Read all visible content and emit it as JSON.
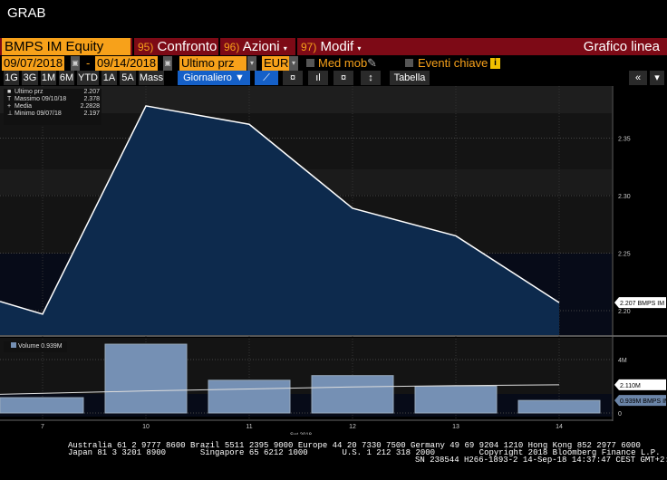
{
  "window_title": "GRAB",
  "menu": {
    "ticker": "BMPS IM Equity",
    "confronto": "Confronto",
    "confronto_num": "95)",
    "azioni": "Azioni",
    "azioni_num": "96)",
    "modif": "Modif",
    "modif_num": "97)",
    "chart_type": "Grafico linea"
  },
  "controls": {
    "start_date": "09/07/2018",
    "dash": "-",
    "end_date": "09/14/2018",
    "field": "Ultimo prz",
    "currency": "EUR",
    "med_mob": "Med mob",
    "eventi": "Eventi chiave"
  },
  "periods": [
    "1G",
    "3G",
    "1M",
    "6M",
    "YTD",
    "1A",
    "5A",
    "Mass"
  ],
  "frequency": "Giornaliero ▼",
  "tabella": "Tabella",
  "legend": [
    {
      "label": "Ultimo prz",
      "value": "2.207"
    },
    {
      "label": "Massimo 09/10/18",
      "value": "2.378"
    },
    {
      "label": "Media",
      "value": "2.2828"
    },
    {
      "label": "Minimo 09/07/18",
      "value": "2.197"
    }
  ],
  "volume_legend": "Volume 0.939M",
  "price_tag": "2.207 BMPS IM",
  "avg_vol_tag": "2.110M",
  "vol_tag": "0.939M BMPS IM",
  "footer": {
    "line1": "Australia 61 2 9777 8600 Brazil 5511 2395 9000 Europe 44 20 7330 7500 Germany 49 69 9204 1210 Hong Kong 852 2977 6000",
    "line2": "Japan 81 3 3201 8900       Singapore 65 6212 1000       U.S. 1 212 318 2000         Copyright 2018 Bloomberg Finance L.P.",
    "line3": "SN 238544 H266-1893-2 14-Sep-18 14:37:47 CEST GMT+2:00"
  },
  "chart_data": {
    "type": "line",
    "x": [
      "7",
      "10",
      "11",
      "12",
      "13",
      "14"
    ],
    "xlabel": "Set 2018",
    "price": {
      "name": "Ultimo prz",
      "values": [
        2.197,
        2.378,
        2.362,
        2.289,
        2.265,
        2.207
      ],
      "prior_value": 2.208,
      "ylim": [
        2.175,
        2.42
      ],
      "ticks": [
        "2.20",
        "2.25",
        "2.30",
        "2.35"
      ]
    },
    "volume": {
      "name": "Volume",
      "values_M": [
        1.15,
        5.15,
        2.45,
        2.8,
        2.0,
        0.939
      ],
      "avg_M": [
        1.4,
        1.65,
        1.8,
        1.95,
        2.05,
        2.11
      ],
      "ylim": [
        0,
        5.4
      ],
      "ticks": [
        "0",
        "4M"
      ]
    },
    "colors": {
      "area": "#0d2a4d",
      "line": "#ffffff",
      "bar": "#7590b4"
    }
  }
}
